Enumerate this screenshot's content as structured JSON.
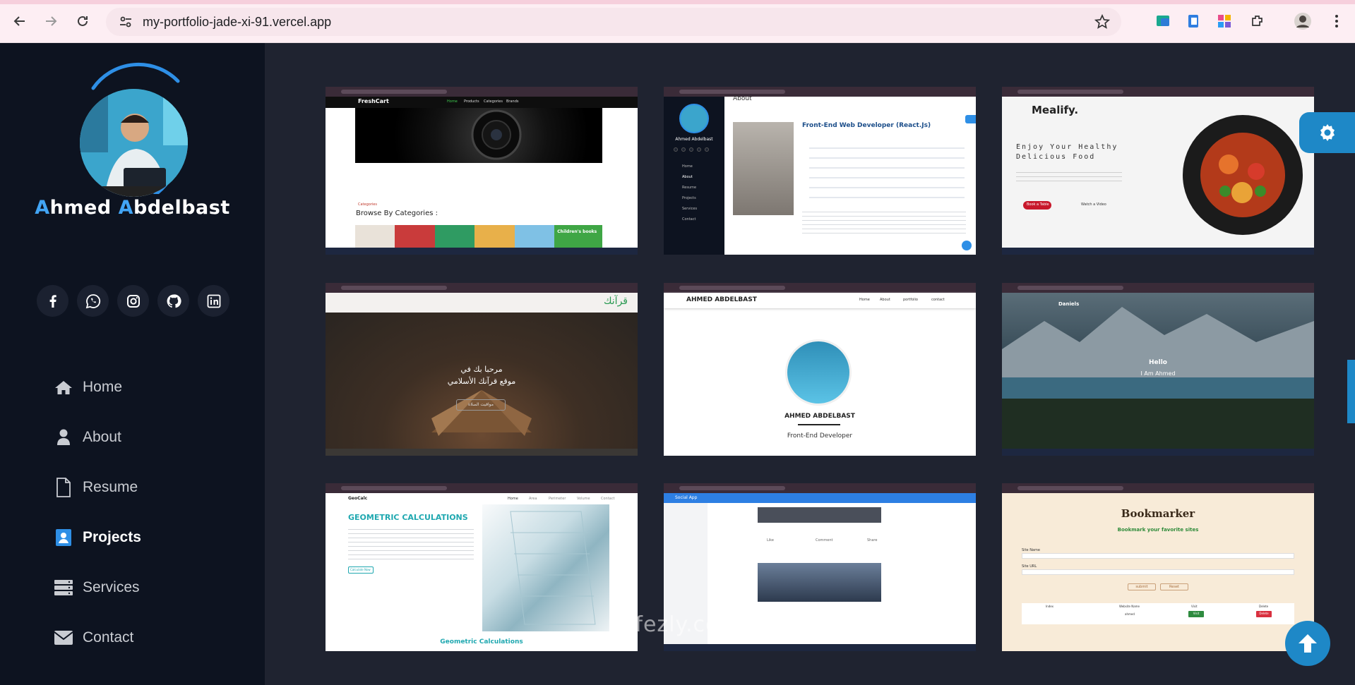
{
  "browser": {
    "url": "my-portfolio-jade-xi-91.vercel.app"
  },
  "profile": {
    "name_first_initial": "A",
    "name_first_rest": "hmed ",
    "name_last_initial": "A",
    "name_last_rest": "bdelbast"
  },
  "socials": [
    "facebook-icon",
    "whatsapp-icon",
    "instagram-icon",
    "github-icon",
    "linkedin-icon"
  ],
  "menu": [
    {
      "label": "Home",
      "icon": "home-icon"
    },
    {
      "label": "About",
      "icon": "user-icon"
    },
    {
      "label": "Resume",
      "icon": "file-icon"
    },
    {
      "label": "Projects",
      "icon": "projects-icon",
      "active": true
    },
    {
      "label": "Services",
      "icon": "server-icon"
    },
    {
      "label": "Contact",
      "icon": "envelope-icon"
    }
  ],
  "projects": {
    "freshcart": {
      "brand": "FreshCart",
      "nav": [
        "Home",
        "Products",
        "Categories",
        "Brands"
      ],
      "section_tag": "Categories",
      "section_title": "Browse By Categories :",
      "promo": "Children's books"
    },
    "react_portfolio": {
      "side_name": "Ahmed Abdelbast",
      "heading": "Front-End Web Developer (React.Js)",
      "section": "About",
      "side_menu": [
        "Home",
        "About",
        "Resume",
        "Projects",
        "Services",
        "Contact"
      ]
    },
    "mealify": {
      "brand": "Mealify.",
      "headline_1": "Enjoy Your Healthy",
      "headline_2": "Delicious Food",
      "cta": "Book a Table",
      "video": "Watch a Video"
    },
    "quran": {
      "brand": "قرآنك",
      "greeting_1": "مرحبا بك في",
      "greeting_2": "موقع قرآنك الأسلامي",
      "cta": "مواقيت الصلاة"
    },
    "bootstrap_portfolio": {
      "brand": "AHMED ABDELBAST",
      "nav": [
        "Home",
        "About",
        "portfolio",
        "contact"
      ],
      "name": "AHMED ABDELBAST",
      "role": "Front-End Developer"
    },
    "daniels": {
      "brand": "Daniels",
      "hello": "Hello",
      "sub": "I Am Ahmed"
    },
    "geocalc": {
      "brand": "GeoCalc",
      "nav": [
        "Home",
        "Area",
        "Perimeter",
        "Volume",
        "Contact"
      ],
      "heading": "GEOMETRIC CALCULATIONS",
      "button": "Calculate Now",
      "footer": "Geometric Calculations"
    },
    "social_app": {
      "brand": "Social App",
      "actions": [
        "Like",
        "Comment",
        "Share"
      ]
    },
    "bookmarker": {
      "brand": "Bookmarker",
      "subtitle": "Bookmark your favorite sites",
      "label_name": "Site Name",
      "label_url": "Site URL",
      "btn_submit": "submit",
      "btn_reset": "Reset",
      "cols": [
        "Index",
        "Website Name",
        "Visit",
        "Delete"
      ],
      "row_name": "ahmed",
      "visit": "Visit",
      "delete": "Delete"
    }
  },
  "watermark": "nafezly.com"
}
